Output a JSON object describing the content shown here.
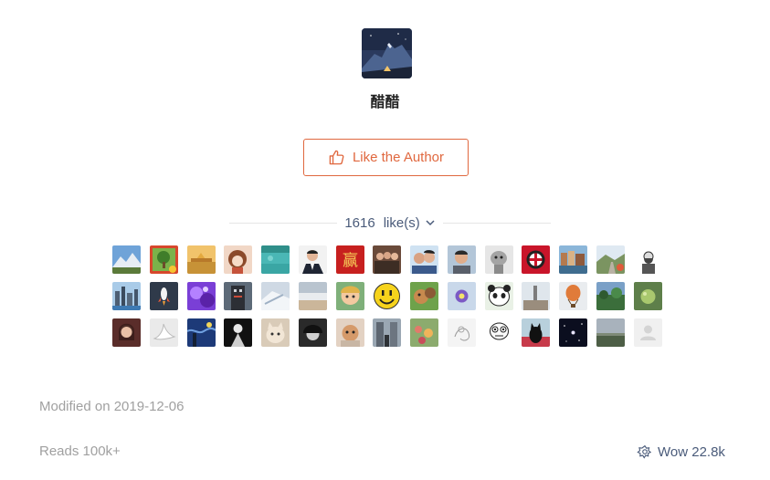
{
  "author": {
    "name": "醋醋",
    "avatar_icon": "mountain-tent-night-icon"
  },
  "like_button": {
    "label": "Like the Author",
    "icon": "thumbs-up-icon",
    "color": "#e0683f"
  },
  "likes": {
    "count": "1616",
    "label": "like(s)",
    "expand_icon": "chevron-down-icon"
  },
  "likers": [
    {
      "icon": "mountain-landscape"
    },
    {
      "icon": "tree-app-icon"
    },
    {
      "icon": "golden-temple"
    },
    {
      "icon": "anime-girl"
    },
    {
      "icon": "turquoise-water"
    },
    {
      "icon": "man-in-suit"
    },
    {
      "icon": "red-chinese-character"
    },
    {
      "icon": "group-photo"
    },
    {
      "icon": "selfie-couple"
    },
    {
      "icon": "man-portrait"
    },
    {
      "icon": "cartoon-character-gray"
    },
    {
      "icon": "ac-milan-logo"
    },
    {
      "icon": "canal-city"
    },
    {
      "icon": "road-landscape"
    },
    {
      "icon": "bearded-sketch"
    },
    {
      "icon": "city-skyline"
    },
    {
      "icon": "rocket-logo"
    },
    {
      "icon": "purple-abstract"
    },
    {
      "icon": "dark-building"
    },
    {
      "icon": "snowy-scene"
    },
    {
      "icon": "frozen-lake"
    },
    {
      "icon": "cartoon-boy"
    },
    {
      "icon": "smiley-face"
    },
    {
      "icon": "cartoon-cat-mouse"
    },
    {
      "icon": "purple-flower"
    },
    {
      "icon": "panda-cartoon"
    },
    {
      "icon": "town-square"
    },
    {
      "icon": "hot-air-balloon"
    },
    {
      "icon": "green-garden"
    },
    {
      "icon": "green-fruit"
    },
    {
      "icon": "woman-portrait"
    },
    {
      "icon": "white-bird"
    },
    {
      "icon": "starry-night"
    },
    {
      "icon": "black-dark-figure"
    },
    {
      "icon": "cat-photo"
    },
    {
      "icon": "hair-portrait"
    },
    {
      "icon": "cat-cushion"
    },
    {
      "icon": "street-photo"
    },
    {
      "icon": "flower-garden"
    },
    {
      "icon": "sketch-drawing"
    },
    {
      "icon": "meme-face"
    },
    {
      "icon": "black-cat"
    },
    {
      "icon": "night-sky"
    },
    {
      "icon": "landscape-dusk"
    },
    {
      "icon": "default-avatar"
    }
  ],
  "modified": "Modified on 2019-12-06",
  "reads": "Reads 100k+",
  "wow": {
    "label": "Wow 22.8k",
    "icon": "wow-flower-icon"
  }
}
